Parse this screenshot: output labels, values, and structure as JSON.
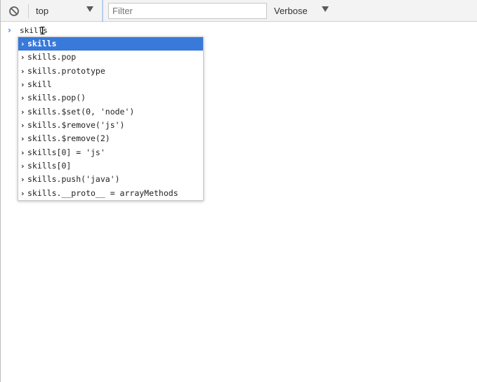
{
  "toolbar": {
    "clear_icon": "block-icon",
    "context": "top",
    "filter_placeholder": "Filter",
    "level": "Verbose",
    "accent_color": "#4a8af4"
  },
  "prompt": {
    "icon": "›",
    "text": "skills"
  },
  "autocomplete": {
    "selected_index": 0,
    "selected_color": "#3879d9",
    "items": [
      "skills",
      "skills.pop",
      "skills.prototype",
      "skill",
      "skills.pop()",
      "skills.$set(0, 'node')",
      "skills.$remove('js')",
      "skills.$remove(2)",
      "skills[0] = 'js'",
      "skills[0]",
      "skills.push('java')",
      "skills.__proto__ = arrayMethods"
    ]
  }
}
